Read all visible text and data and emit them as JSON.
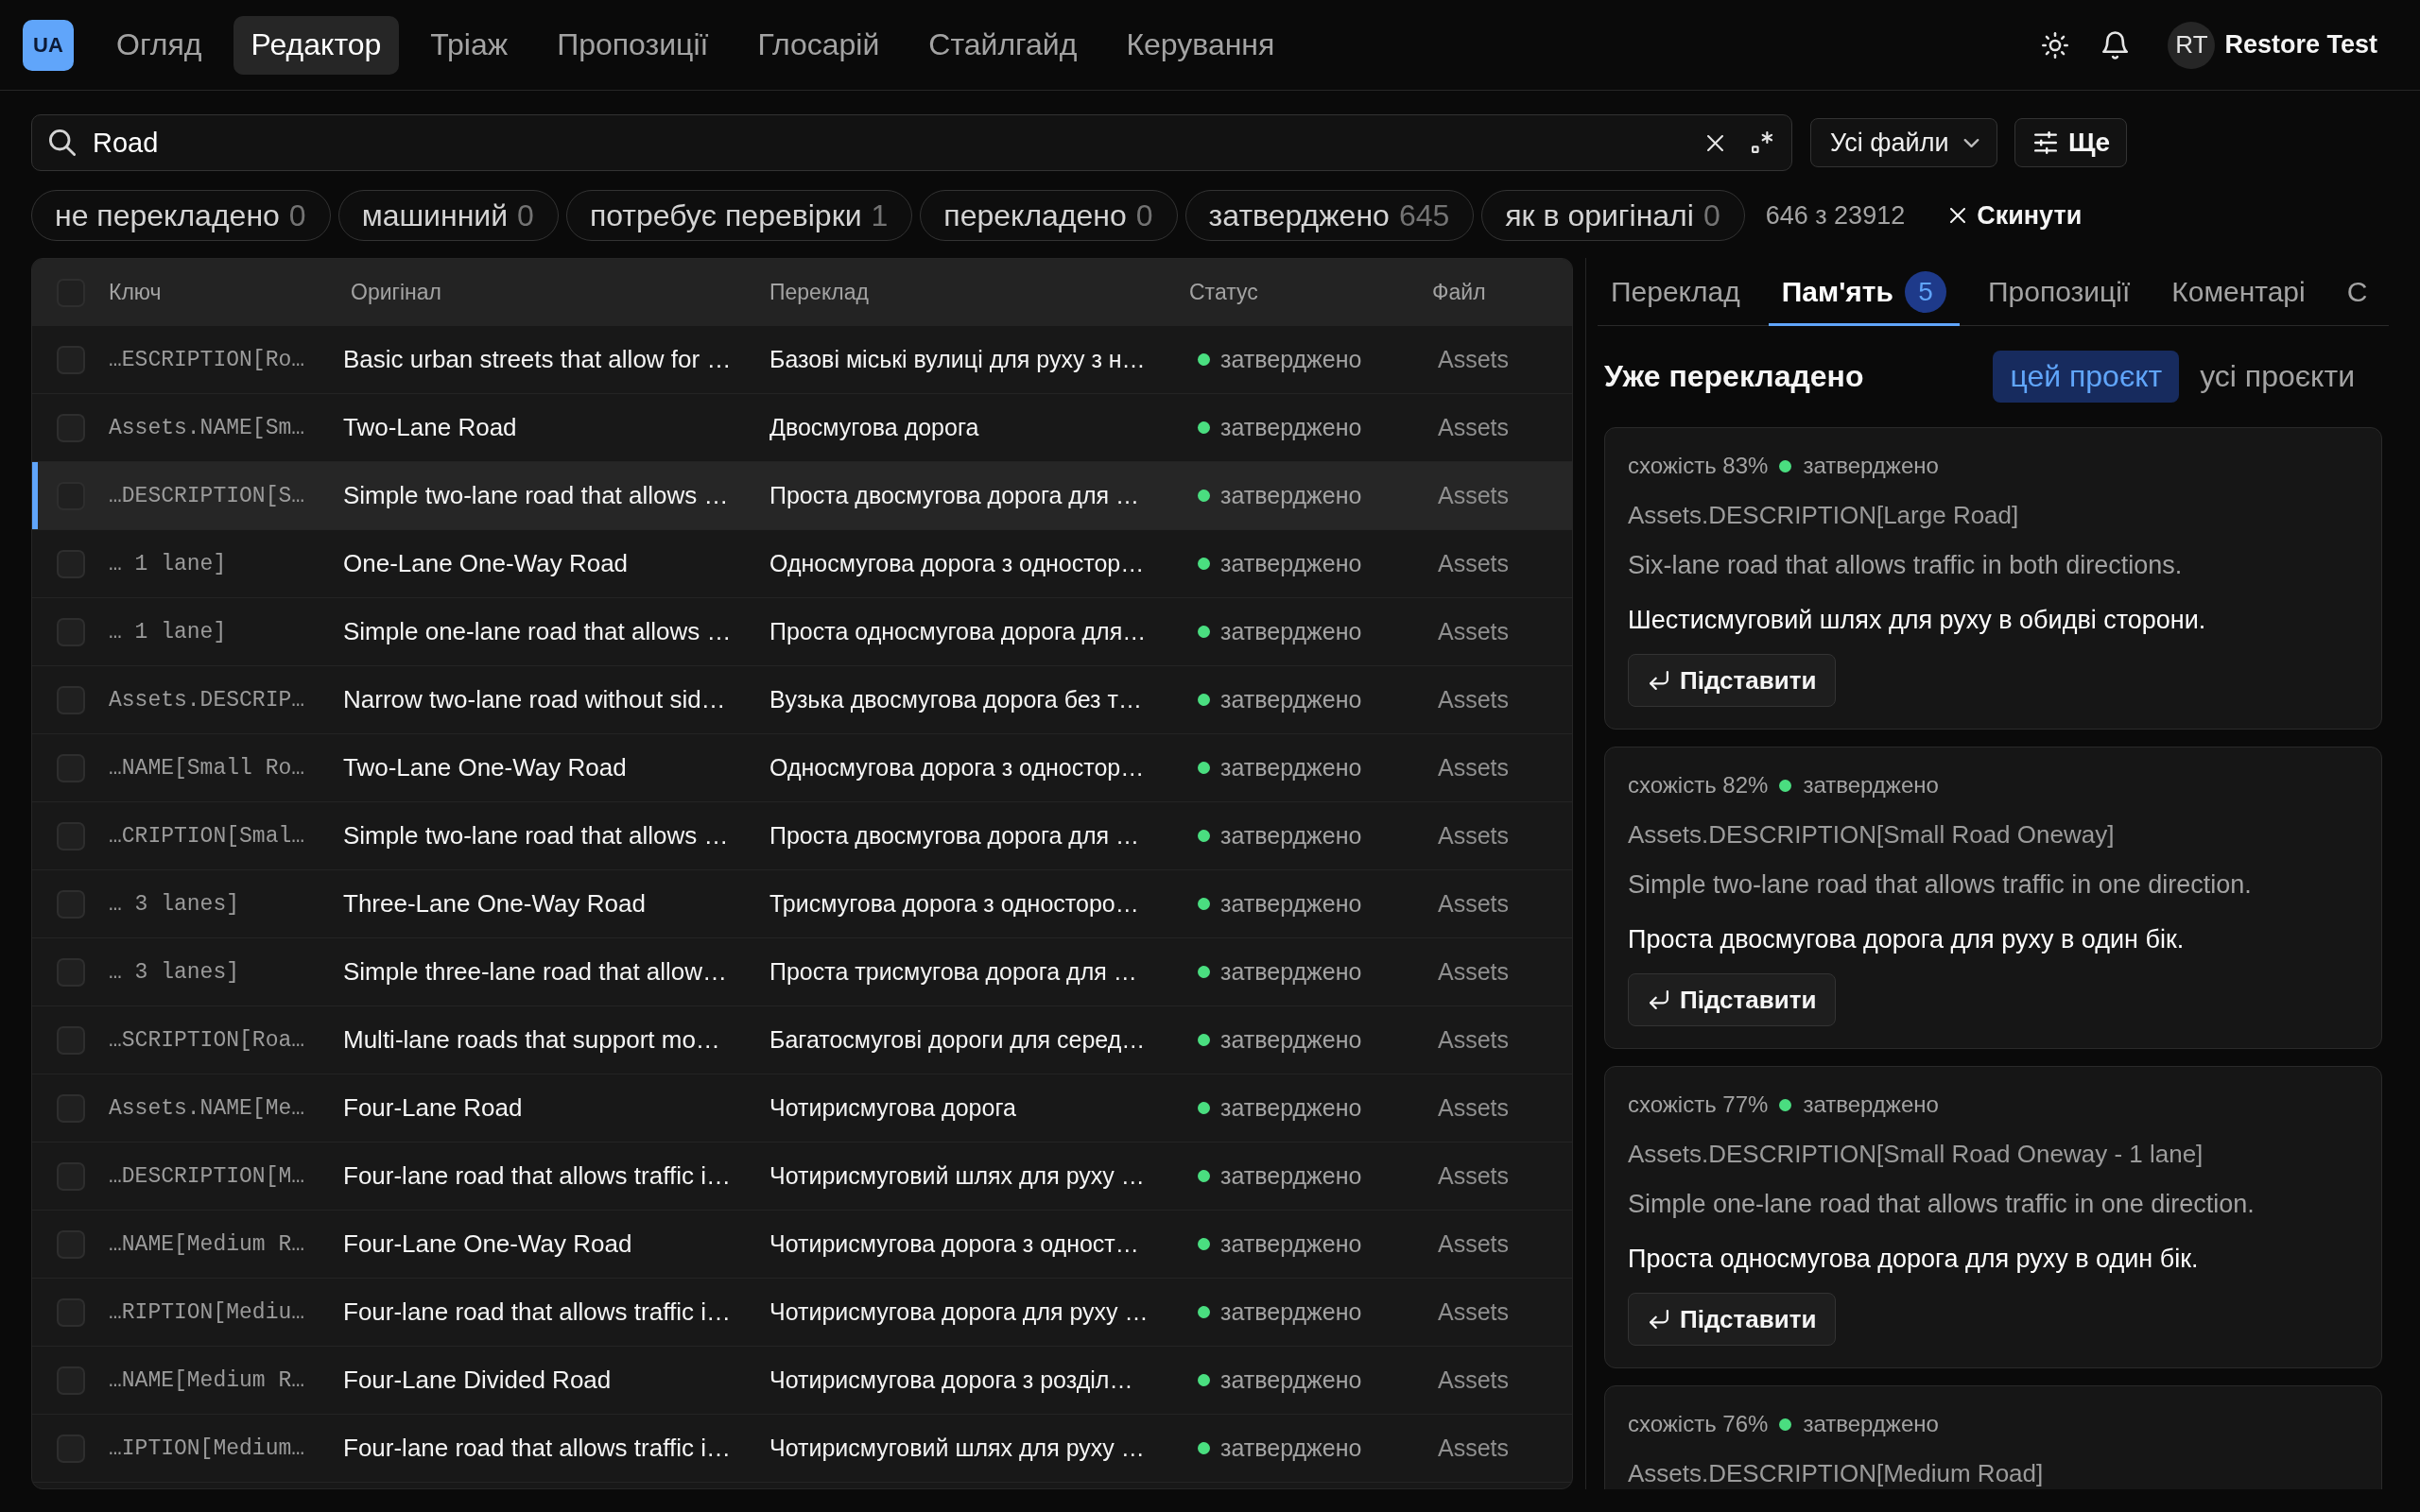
{
  "app_bar": {
    "logo": "UA",
    "nav": [
      {
        "label": "Огляд",
        "selected": false
      },
      {
        "label": "Редактор",
        "selected": true
      },
      {
        "label": "Тріаж",
        "selected": false
      },
      {
        "label": "Пропозиції",
        "selected": false
      },
      {
        "label": "Глосарій",
        "selected": false
      },
      {
        "label": "Стайлгайд",
        "selected": false
      },
      {
        "label": "Керування",
        "selected": false
      }
    ],
    "user": {
      "initials": "RT",
      "name": "Restore Test"
    }
  },
  "toolbar": {
    "search": {
      "value": "Road"
    },
    "file_filter": "Усі файли",
    "more_button": "Ще"
  },
  "status_filters": [
    {
      "label": "не перекладено",
      "count": "0"
    },
    {
      "label": "машинний",
      "count": "0"
    },
    {
      "label": "потребує перевірки",
      "count": "1"
    },
    {
      "label": "перекладено",
      "count": "0"
    },
    {
      "label": "затверджено",
      "count": "645"
    },
    {
      "label": "як в оригіналі",
      "count": "0"
    }
  ],
  "result_count": "646 з 23912",
  "reset_button": "Скинути",
  "table": {
    "all_checked": false,
    "columns": [
      "Ключ",
      "Оригінал",
      "Переклад",
      "Статус",
      "Файл"
    ],
    "rows": [
      {
        "key": "…ESCRIPTION[Ro…",
        "original": "Basic urban streets that allow for …",
        "translation": "Базові міські вулиці для руху з н…",
        "status": "затверджено",
        "file": "Assets",
        "checked": false,
        "selected": false
      },
      {
        "key": "Assets.NAME[Sm…",
        "original": "Two-Lane Road",
        "translation": "Двосмугова дорога",
        "status": "затверджено",
        "file": "Assets",
        "checked": false,
        "selected": false
      },
      {
        "key": "…DESCRIPTION[S…",
        "original": "Simple two-lane road that allows …",
        "translation": "Проста двосмугова дорога для …",
        "status": "затверджено",
        "file": "Assets",
        "checked": false,
        "selected": true
      },
      {
        "key": "… 1 lane]",
        "original": "One-Lane One-Way Road",
        "translation": "Односмугова дорога з одностор…",
        "status": "затверджено",
        "file": "Assets",
        "checked": false,
        "selected": false
      },
      {
        "key": "… 1 lane]",
        "original": "Simple one-lane road that allows …",
        "translation": "Проста односмугова дорога для…",
        "status": "затверджено",
        "file": "Assets",
        "checked": false,
        "selected": false
      },
      {
        "key": "Assets.DESCRIP…",
        "original": "Narrow two-lane road without sid…",
        "translation": "Вузька двосмугова дорога без т…",
        "status": "затверджено",
        "file": "Assets",
        "checked": false,
        "selected": false
      },
      {
        "key": "…NAME[Small Ro…",
        "original": "Two-Lane One-Way Road",
        "translation": "Односмугова дорога з одностор…",
        "status": "затверджено",
        "file": "Assets",
        "checked": false,
        "selected": false
      },
      {
        "key": "…CRIPTION[Smal…",
        "original": "Simple two-lane road that allows …",
        "translation": "Проста двосмугова дорога для …",
        "status": "затверджено",
        "file": "Assets",
        "checked": false,
        "selected": false
      },
      {
        "key": "… 3 lanes]",
        "original": "Three-Lane One-Way Road",
        "translation": "Трисмугова дорога з односторо…",
        "status": "затверджено",
        "file": "Assets",
        "checked": false,
        "selected": false
      },
      {
        "key": "… 3 lanes]",
        "original": "Simple three-lane road that allow…",
        "translation": "Проста трисмугова дорога для …",
        "status": "затверджено",
        "file": "Assets",
        "checked": false,
        "selected": false
      },
      {
        "key": "…SCRIPTION[Roa…",
        "original": "Multi-lane roads that support mo…",
        "translation": "Багатосмугові дороги для серед…",
        "status": "затверджено",
        "file": "Assets",
        "checked": false,
        "selected": false
      },
      {
        "key": "Assets.NAME[Me…",
        "original": "Four-Lane Road",
        "translation": "Чотирисмугова дорога",
        "status": "затверджено",
        "file": "Assets",
        "checked": false,
        "selected": false
      },
      {
        "key": "…DESCRIPTION[M…",
        "original": "Four-lane road that allows traffic i…",
        "translation": "Чотирисмуговий шлях для руху …",
        "status": "затверджено",
        "file": "Assets",
        "checked": false,
        "selected": false
      },
      {
        "key": "…NAME[Medium R…",
        "original": "Four-Lane One-Way Road",
        "translation": "Чотирисмугова дорога з одност…",
        "status": "затверджено",
        "file": "Assets",
        "checked": false,
        "selected": false
      },
      {
        "key": "…RIPTION[Mediu…",
        "original": "Four-lane road that allows traffic i…",
        "translation": "Чотирисмугова дорога для руху …",
        "status": "затверджено",
        "file": "Assets",
        "checked": false,
        "selected": false
      },
      {
        "key": "…NAME[Medium R…",
        "original": "Four-Lane Divided Road",
        "translation": "Чотирисмугова дорога з розділ…",
        "status": "затверджено",
        "file": "Assets",
        "checked": false,
        "selected": false
      },
      {
        "key": "…IPTION[Medium…",
        "original": "Four-lane road that allows traffic i…",
        "translation": "Чотирисмуговий шлях для руху …",
        "status": "затверджено",
        "file": "Assets",
        "checked": false,
        "selected": false
      }
    ]
  },
  "side_panel": {
    "tabs": [
      {
        "label": "Переклад",
        "selected": false
      },
      {
        "label": "Пам'ять",
        "badge": "5",
        "selected": true
      },
      {
        "label": "Пропозиції",
        "selected": false
      },
      {
        "label": "Коментарі",
        "selected": false
      },
      {
        "label": "С",
        "selected": false
      }
    ],
    "memory": {
      "heading": "Уже перекладено",
      "scope": [
        {
          "label": "цей проєкт",
          "selected": true
        },
        {
          "label": "усі проєкти",
          "selected": false
        }
      ],
      "matches": [
        {
          "similarity": "схожість 83%",
          "status": "затверджено",
          "key": "Assets.DESCRIPTION[Large Road]",
          "source": "Six-lane road that allows traffic in both directions.",
          "target": "Шестисмуговий шлях для руху в обидві сторони.",
          "button": "Підставити"
        },
        {
          "similarity": "схожість 82%",
          "status": "затверджено",
          "key": "Assets.DESCRIPTION[Small Road Oneway]",
          "source": "Simple two-lane road that allows traffic in one direction.",
          "target": "Проста двосмугова дорога для руху в один бік.",
          "button": "Підставити"
        },
        {
          "similarity": "схожість 77%",
          "status": "затверджено",
          "key": "Assets.DESCRIPTION[Small Road Oneway - 1 lane]",
          "source": "Simple one-lane road that allows traffic in one direction.",
          "target": "Проста односмугова дорога для руху в один бік.",
          "button": "Підставити"
        },
        {
          "similarity": "схожість 76%",
          "status": "затверджено",
          "key": "Assets.DESCRIPTION[Medium Road]"
        }
      ]
    }
  }
}
